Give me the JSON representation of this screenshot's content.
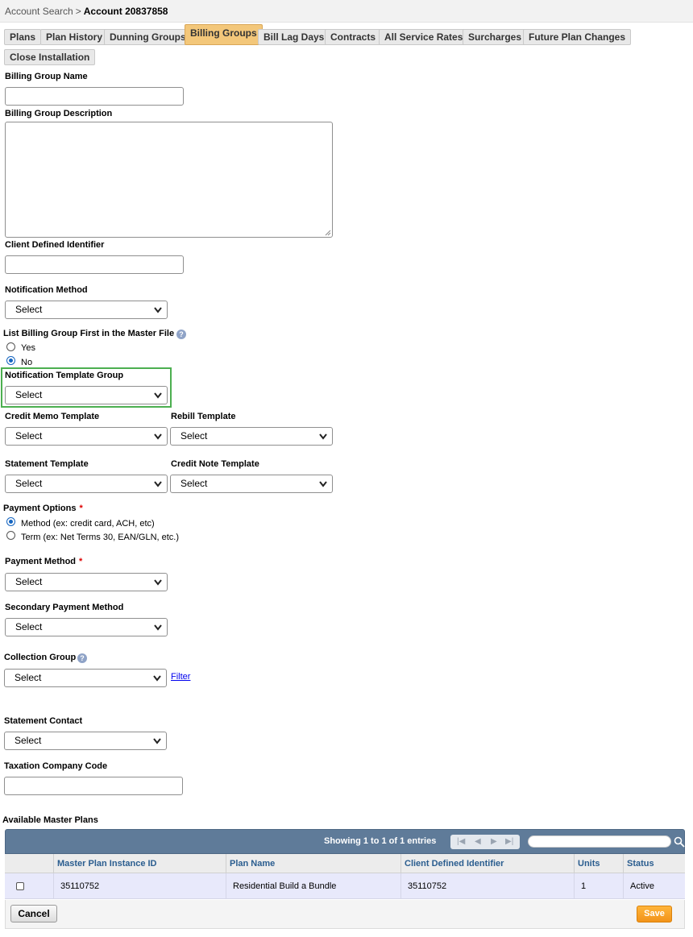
{
  "breadcrumb": {
    "root": "Account Search",
    "separator": ">",
    "current": "Account 20837858"
  },
  "tabs": [
    {
      "label": "Plans",
      "active": false
    },
    {
      "label": "Plan History",
      "active": false
    },
    {
      "label": "Dunning Groups",
      "active": false
    },
    {
      "label": "Billing Groups",
      "active": true
    },
    {
      "label": "Bill Lag Days",
      "active": false
    },
    {
      "label": "Contracts",
      "active": false
    },
    {
      "label": "All Service Rates",
      "active": false
    },
    {
      "label": "Surcharges",
      "active": false
    },
    {
      "label": "Future Plan Changes",
      "active": false
    },
    {
      "label": "Close Installation",
      "active": false
    }
  ],
  "form": {
    "billing_group_name": {
      "label": "Billing Group Name",
      "value": ""
    },
    "billing_group_description": {
      "label": "Billing Group Description",
      "value": ""
    },
    "client_defined_identifier": {
      "label": "Client Defined Identifier",
      "value": ""
    },
    "notification_method": {
      "label": "Notification Method",
      "selected": "Select"
    },
    "list_first": {
      "label": "List Billing Group First in the Master File",
      "options": [
        {
          "label": "Yes",
          "checked": false
        },
        {
          "label": "No",
          "checked": true
        }
      ]
    },
    "notification_template_group": {
      "label": "Notification Template Group",
      "selected": "Select"
    },
    "credit_memo_template": {
      "label": "Credit Memo Template",
      "selected": "Select"
    },
    "rebill_template": {
      "label": "Rebill Template",
      "selected": "Select"
    },
    "statement_template": {
      "label": "Statement Template",
      "selected": "Select"
    },
    "credit_note_template": {
      "label": "Credit Note Template",
      "selected": "Select"
    },
    "payment_options": {
      "label": "Payment Options",
      "required_mark": "*",
      "options": [
        {
          "label": "Method (ex: credit card, ACH, etc)",
          "checked": true
        },
        {
          "label": "Term (ex: Net Terms 30, EAN/GLN, etc.)",
          "checked": false
        }
      ]
    },
    "payment_method": {
      "label": "Payment Method",
      "required_mark": "*",
      "selected": "Select"
    },
    "secondary_payment_method": {
      "label": "Secondary Payment Method",
      "selected": "Select"
    },
    "collection_group": {
      "label": "Collection Group",
      "selected": "Select",
      "filter_link": "Filter"
    },
    "statement_contact": {
      "label": "Statement Contact",
      "selected": "Select"
    },
    "taxation_company_code": {
      "label": "Taxation Company Code",
      "value": ""
    }
  },
  "plans_grid": {
    "title": "Available Master Plans",
    "showing": "Showing 1 to 1 of 1 entries",
    "pager_icons": [
      "first-page-icon",
      "prev-page-icon",
      "next-page-icon",
      "last-page-icon"
    ],
    "columns": [
      "Master Plan Instance ID",
      "Plan Name",
      "Client Defined Identifier",
      "Units",
      "Status"
    ],
    "rows": [
      {
        "checked": false,
        "cells": [
          "35110752",
          "Residential Build a Bundle",
          "35110752",
          "1",
          "Active"
        ]
      }
    ]
  },
  "buttons": {
    "cancel": "Cancel",
    "save": "Save"
  },
  "colors": {
    "active_tab": "#f3c77a",
    "highlight_border": "#4caf50",
    "grid_header": "#5f7b99",
    "row_bg": "#e8e9fb",
    "save_button": "#f2931a",
    "required": "#dd0000"
  }
}
